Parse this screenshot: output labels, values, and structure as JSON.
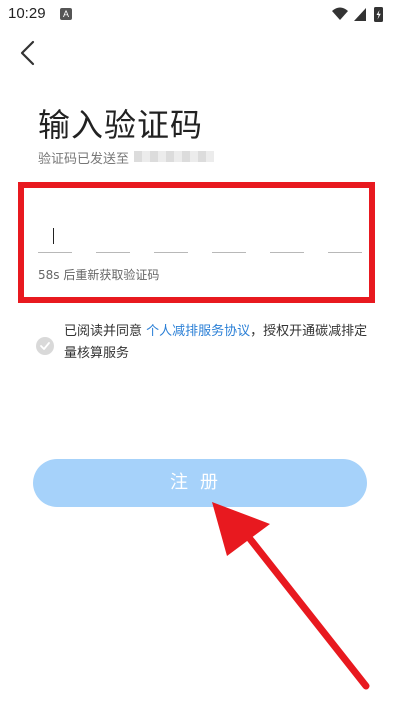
{
  "status_bar": {
    "time": "10:29",
    "notification_icon": "A"
  },
  "header": {
    "back_icon": "chevron-left-icon"
  },
  "page": {
    "title": "输入验证码",
    "subtitle": "验证码已发送至"
  },
  "code_input": {
    "slots": 6,
    "resend_text": "58s 后重新获取验证码"
  },
  "agreement": {
    "prefix": "已阅读并同意 ",
    "link": "个人减排服务协议",
    "suffix": "，授权开通碳减排定量核算服务"
  },
  "register_button": {
    "label": "注册"
  },
  "colors": {
    "highlight_border": "#e8191f",
    "button_bg": "#a6d2fa",
    "link": "#2a7fd6",
    "arrow": "#e8191f"
  }
}
